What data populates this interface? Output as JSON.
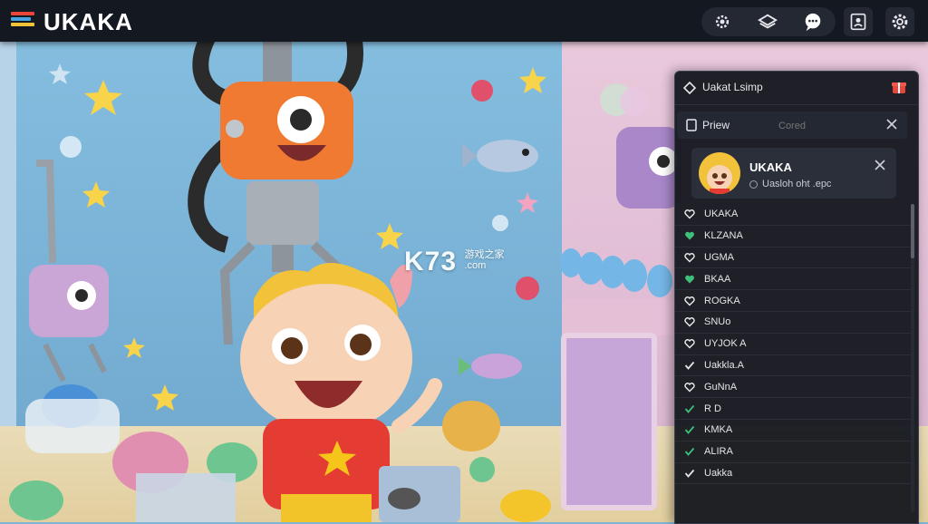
{
  "app": {
    "logo_text": "UKAKA"
  },
  "colors": {
    "accent": "#e8463a",
    "panel_bg": "#14171e",
    "topbar_bg": "#141821"
  },
  "toolbar": {
    "icons": [
      "gear-icon",
      "layers-icon",
      "chat-bubble-icon",
      "profile-frame-icon",
      "settings-icon"
    ]
  },
  "watermark": {
    "brand": "K73",
    "site": "游戏之家",
    "domain": ".com"
  },
  "panel": {
    "title": "Uakat Lsimp",
    "search": {
      "label": "Priew",
      "placeholder": "Cored"
    },
    "card": {
      "name": "UKAKA",
      "subtitle": "Uasloh oht .epc"
    },
    "items": [
      {
        "label": "UKAKA",
        "icon": "heart-outline-icon",
        "icon_color": "#e4e5e9"
      },
      {
        "label": "KLZANA",
        "icon": "heart-filled-icon",
        "icon_color": "#3fbf7a"
      },
      {
        "label": "UGMA",
        "icon": "heart-outline-icon",
        "icon_color": "#e4e5e9"
      },
      {
        "label": "BKAA",
        "icon": "heart-filled-icon",
        "icon_color": "#3fbf7a"
      },
      {
        "label": "ROGKA",
        "icon": "heart-outline-icon",
        "icon_color": "#e4e5e9"
      },
      {
        "label": "SNUo",
        "icon": "heart-outline-icon",
        "icon_color": "#e4e5e9"
      },
      {
        "label": "UYJOK A",
        "icon": "heart-outline-icon",
        "icon_color": "#e4e5e9"
      },
      {
        "label": "Uakkla.A",
        "icon": "check-icon",
        "icon_color": "#e4e5e9"
      },
      {
        "label": "GuNnA",
        "icon": "heart-outline-icon",
        "icon_color": "#e4e5e9"
      },
      {
        "label": "R D",
        "icon": "check-icon",
        "icon_color": "#3fbf7a"
      },
      {
        "label": "KMKA",
        "icon": "check-icon",
        "icon_color": "#3fbf7a"
      },
      {
        "label": "ALIRA",
        "icon": "check-icon",
        "icon_color": "#3fbf7a"
      },
      {
        "label": "Uakka",
        "icon": "check-icon",
        "icon_color": "#e4e5e9"
      }
    ]
  }
}
